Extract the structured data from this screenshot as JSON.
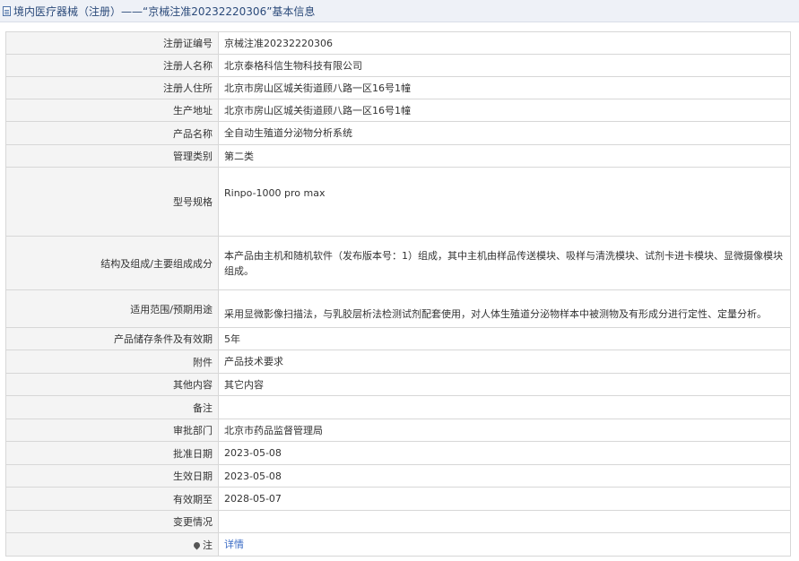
{
  "header": {
    "title": "境内医疗器械（注册）——“京械注准20232220306”基本信息"
  },
  "rows": [
    {
      "label": "注册证编号",
      "value": "京械注准20232220306"
    },
    {
      "label": "注册人名称",
      "value": "北京泰格科信生物科技有限公司"
    },
    {
      "label": "注册人住所",
      "value": "北京市房山区城关街道顾八路一区16号1幢"
    },
    {
      "label": "生产地址",
      "value": "北京市房山区城关街道顾八路一区16号1幢"
    },
    {
      "label": "产品名称",
      "value": "全自动生殖道分泌物分析系统"
    },
    {
      "label": "管理类别",
      "value": "第二类"
    },
    {
      "label": "型号规格",
      "value": "Rinpo-1000 pro max"
    },
    {
      "label": "结构及组成/主要组成成分",
      "value": "本产品由主机和随机软件（发布版本号：1）组成，其中主机由样品传送模块、吸样与清洗模块、试剂卡进卡模块、显微摄像模块组成。"
    },
    {
      "label": "适用范围/预期用途",
      "value": "采用显微影像扫描法，与乳胶层析法检测试剂配套使用，对人体生殖道分泌物样本中被测物及有形成分进行定性、定量分析。"
    },
    {
      "label": "产品储存条件及有效期",
      "value": "5年"
    },
    {
      "label": "附件",
      "value": "产品技术要求"
    },
    {
      "label": "其他内容",
      "value": "其它内容"
    },
    {
      "label": "备注",
      "value": ""
    },
    {
      "label": "审批部门",
      "value": "北京市药品监督管理局"
    },
    {
      "label": "批准日期",
      "value": "2023-05-08"
    },
    {
      "label": "生效日期",
      "value": "2023-05-08"
    },
    {
      "label": "有效期至",
      "value": "2028-05-07"
    },
    {
      "label": "变更情况",
      "value": ""
    },
    {
      "label": "注",
      "value": "详情"
    }
  ],
  "icons": {
    "header": "document-icon",
    "note": "pin-icon"
  },
  "colors": {
    "header_bg": "#eef1f7",
    "label_bg": "#f4f4f4",
    "link": "#3a6bc5"
  }
}
